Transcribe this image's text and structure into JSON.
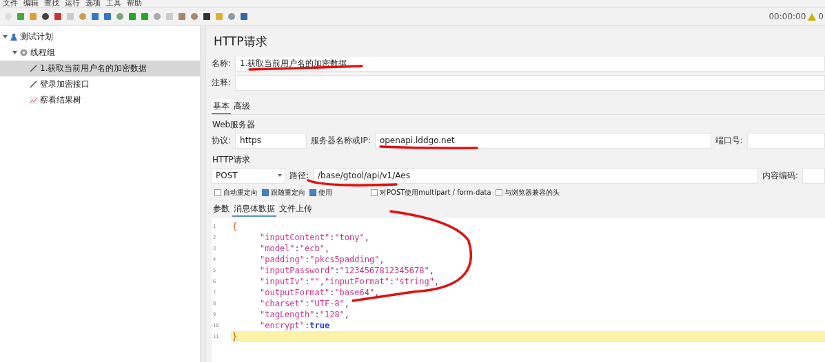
{
  "menu": [
    "文件",
    "编辑",
    "查找",
    "运行",
    "选项",
    "工具",
    "帮助"
  ],
  "status": {
    "timer": "00:00:00",
    "warnings": "0"
  },
  "tree": [
    {
      "label": "测试计划",
      "kind": "plan",
      "expanded": true,
      "selected": false,
      "children": [
        {
          "label": "线程组",
          "kind": "group",
          "expanded": true,
          "selected": false,
          "children": [
            {
              "label": "1.获取当前用户名的加密数据",
              "kind": "sampler",
              "selected": true
            },
            {
              "label": "登录加密接口",
              "kind": "sampler",
              "selected": false
            },
            {
              "label": "察看结果树",
              "kind": "listener",
              "selected": false
            }
          ]
        }
      ]
    }
  ],
  "panel": {
    "title": "HTTP请求",
    "name_label": "名称:",
    "name_value": "1.获取当前用户名的加密数据",
    "comment_label": "注释:",
    "tabs": [
      {
        "label": "基本",
        "selected": true
      },
      {
        "label": "高级",
        "selected": false
      }
    ],
    "server_group": "Web服务器",
    "protocol_label": "协议:",
    "protocol_value": "https",
    "server_label": "服务器名称或IP:",
    "server_value": "openapi.lddgo.net",
    "port_label": "端口号:",
    "request_group": "HTTP请求",
    "method": "POST",
    "path_label": "路径:",
    "path_value": "/base/gtool/api/v1/Aes",
    "encoding_label": "内容编码:",
    "options": [
      {
        "label": "自动重定向",
        "checked": false
      },
      {
        "label": "跟随重定向",
        "checked": true
      },
      {
        "label": "使用",
        "checked": true
      },
      {
        "label": "对POST使用multipart / form-data",
        "checked": false
      },
      {
        "label": "与浏览器兼容的头",
        "checked": false
      }
    ],
    "subtabs": [
      {
        "label": "参数",
        "selected": false
      },
      {
        "label": "消息体数据",
        "selected": true
      },
      {
        "label": "文件上传",
        "selected": false
      }
    ],
    "code": [
      {
        "number": "1",
        "current": false,
        "tokens": [
          {
            "kind": "brace",
            "text": "{"
          }
        ]
      },
      {
        "number": "2",
        "current": false,
        "tokens": [
          {
            "kind": "key",
            "text": "\"inputContent\""
          },
          {
            "kind": "punct",
            "text": ":"
          },
          {
            "kind": "key",
            "text": "\"tony\""
          },
          {
            "kind": "punct",
            "text": ","
          }
        ]
      },
      {
        "number": "3",
        "current": false,
        "tokens": [
          {
            "kind": "key",
            "text": "\"model\""
          },
          {
            "kind": "punct",
            "text": ":"
          },
          {
            "kind": "key",
            "text": "\"ecb\""
          },
          {
            "kind": "punct",
            "text": ","
          }
        ]
      },
      {
        "number": "4",
        "current": false,
        "tokens": [
          {
            "kind": "key",
            "text": "\"padding\""
          },
          {
            "kind": "punct",
            "text": ":"
          },
          {
            "kind": "key",
            "text": "\"pkcs5padding\""
          },
          {
            "kind": "punct",
            "text": ","
          }
        ]
      },
      {
        "number": "5",
        "current": false,
        "tokens": [
          {
            "kind": "key",
            "text": "\"inputPassword\""
          },
          {
            "kind": "punct",
            "text": ":"
          },
          {
            "kind": "key",
            "text": "\"1234567812345678\""
          },
          {
            "kind": "punct",
            "text": ","
          }
        ]
      },
      {
        "number": "6",
        "current": false,
        "tokens": [
          {
            "kind": "key",
            "text": "\"inputIv\""
          },
          {
            "kind": "punct",
            "text": ":"
          },
          {
            "kind": "key",
            "text": "\"\""
          },
          {
            "kind": "punct",
            "text": ","
          },
          {
            "kind": "key",
            "text": "\"inputFormat\""
          },
          {
            "kind": "punct",
            "text": ":"
          },
          {
            "kind": "key",
            "text": "\"string\""
          },
          {
            "kind": "punct",
            "text": ","
          }
        ]
      },
      {
        "number": "7",
        "current": false,
        "tokens": [
          {
            "kind": "key",
            "text": "\"outputFormat\""
          },
          {
            "kind": "punct",
            "text": ":"
          },
          {
            "kind": "key",
            "text": "\"base64\""
          },
          {
            "kind": "punct",
            "text": ","
          }
        ]
      },
      {
        "number": "8",
        "current": false,
        "tokens": [
          {
            "kind": "key",
            "text": "\"charset\""
          },
          {
            "kind": "punct",
            "text": ":"
          },
          {
            "kind": "key",
            "text": "\"UTF-8\""
          },
          {
            "kind": "punct",
            "text": ","
          }
        ]
      },
      {
        "number": "9",
        "current": false,
        "tokens": [
          {
            "kind": "key",
            "text": "\"tagLength\""
          },
          {
            "kind": "punct",
            "text": ":"
          },
          {
            "kind": "key",
            "text": "\"128\""
          },
          {
            "kind": "punct",
            "text": ","
          }
        ]
      },
      {
        "number": "10",
        "current": false,
        "tokens": [
          {
            "kind": "key",
            "text": "\"encrypt\""
          },
          {
            "kind": "punct",
            "text": ":"
          },
          {
            "kind": "bool",
            "text": "true"
          }
        ]
      },
      {
        "number": "11",
        "current": true,
        "tokens": [
          {
            "kind": "brace",
            "text": "}"
          }
        ]
      }
    ]
  }
}
